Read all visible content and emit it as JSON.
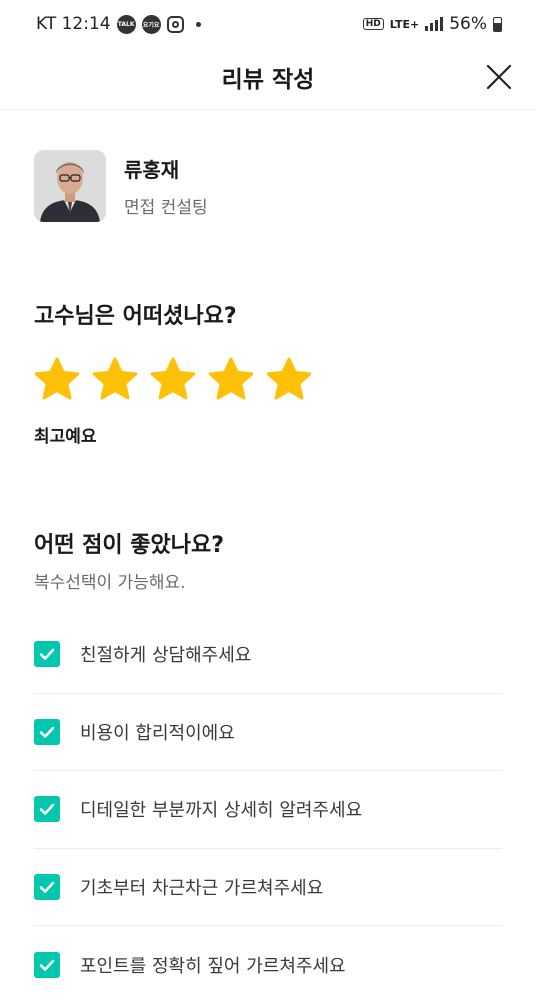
{
  "status_bar": {
    "carrier_time": "KT 12:14",
    "talk_badge": "TALK",
    "kakao_badge": "요기요",
    "hd": "HD",
    "lte": "LTE+",
    "battery": "56%"
  },
  "header": {
    "title": "리뷰 작성"
  },
  "expert": {
    "name": "류홍재",
    "service": "면접 컨설팅"
  },
  "rating": {
    "question": "고수님은 어떠셨나요?",
    "value": 5,
    "max": 5,
    "label": "최고예요",
    "star_color": "#FFC107"
  },
  "good_points": {
    "question": "어떤 점이 좋았나요?",
    "subtitle": "복수선택이 가능해요.",
    "check_color": "#00C7AE",
    "options": [
      {
        "label": "친절하게 상담해주세요",
        "checked": true
      },
      {
        "label": "비용이 합리적이에요",
        "checked": true
      },
      {
        "label": "디테일한 부분까지 상세히 알려주세요",
        "checked": true
      },
      {
        "label": "기초부터 차근차근 가르쳐주세요",
        "checked": true
      },
      {
        "label": "포인트를 정확히 짚어 가르쳐주세요",
        "checked": true
      }
    ]
  }
}
